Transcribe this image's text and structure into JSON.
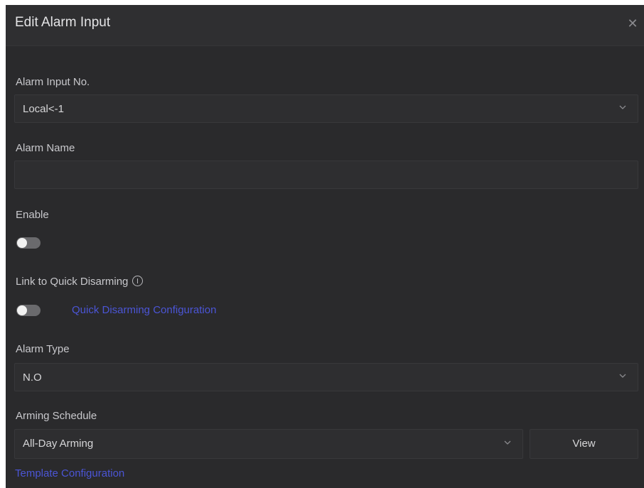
{
  "dialog": {
    "title": "Edit Alarm Input",
    "close_icon": "close-icon"
  },
  "alarm_input_no": {
    "label": "Alarm Input No.",
    "value": "Local<-1"
  },
  "alarm_name": {
    "label": "Alarm Name",
    "value": ""
  },
  "enable": {
    "label": "Enable",
    "on": false
  },
  "quick_disarming": {
    "label": "Link to Quick Disarming",
    "on": false,
    "link": "Quick Disarming Configuration"
  },
  "alarm_type": {
    "label": "Alarm Type",
    "value": "N.O"
  },
  "arming_schedule": {
    "label": "Arming Schedule",
    "value": "All-Day Arming",
    "view_label": "View",
    "template_link": "Template Configuration"
  },
  "colors": {
    "background": "#2a2a2c",
    "link": "#4b55d6",
    "toggle_off": "#6a6a6d"
  }
}
